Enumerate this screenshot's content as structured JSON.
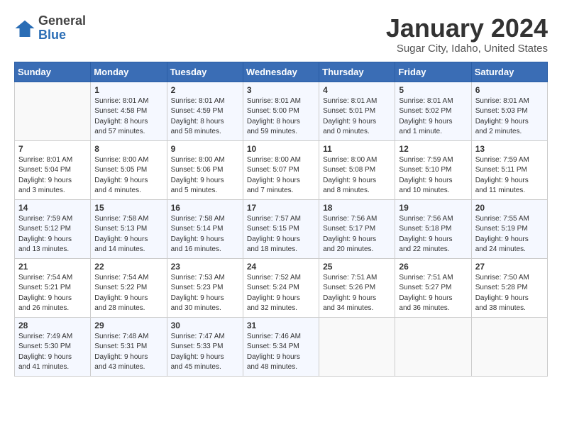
{
  "header": {
    "logo_general": "General",
    "logo_blue": "Blue",
    "month_title": "January 2024",
    "location": "Sugar City, Idaho, United States"
  },
  "days_of_week": [
    "Sunday",
    "Monday",
    "Tuesday",
    "Wednesday",
    "Thursday",
    "Friday",
    "Saturday"
  ],
  "weeks": [
    [
      {
        "day": "",
        "info": ""
      },
      {
        "day": "1",
        "info": "Sunrise: 8:01 AM\nSunset: 4:58 PM\nDaylight: 8 hours\nand 57 minutes."
      },
      {
        "day": "2",
        "info": "Sunrise: 8:01 AM\nSunset: 4:59 PM\nDaylight: 8 hours\nand 58 minutes."
      },
      {
        "day": "3",
        "info": "Sunrise: 8:01 AM\nSunset: 5:00 PM\nDaylight: 8 hours\nand 59 minutes."
      },
      {
        "day": "4",
        "info": "Sunrise: 8:01 AM\nSunset: 5:01 PM\nDaylight: 9 hours\nand 0 minutes."
      },
      {
        "day": "5",
        "info": "Sunrise: 8:01 AM\nSunset: 5:02 PM\nDaylight: 9 hours\nand 1 minute."
      },
      {
        "day": "6",
        "info": "Sunrise: 8:01 AM\nSunset: 5:03 PM\nDaylight: 9 hours\nand 2 minutes."
      }
    ],
    [
      {
        "day": "7",
        "info": "Sunrise: 8:01 AM\nSunset: 5:04 PM\nDaylight: 9 hours\nand 3 minutes."
      },
      {
        "day": "8",
        "info": "Sunrise: 8:00 AM\nSunset: 5:05 PM\nDaylight: 9 hours\nand 4 minutes."
      },
      {
        "day": "9",
        "info": "Sunrise: 8:00 AM\nSunset: 5:06 PM\nDaylight: 9 hours\nand 5 minutes."
      },
      {
        "day": "10",
        "info": "Sunrise: 8:00 AM\nSunset: 5:07 PM\nDaylight: 9 hours\nand 7 minutes."
      },
      {
        "day": "11",
        "info": "Sunrise: 8:00 AM\nSunset: 5:08 PM\nDaylight: 9 hours\nand 8 minutes."
      },
      {
        "day": "12",
        "info": "Sunrise: 7:59 AM\nSunset: 5:10 PM\nDaylight: 9 hours\nand 10 minutes."
      },
      {
        "day": "13",
        "info": "Sunrise: 7:59 AM\nSunset: 5:11 PM\nDaylight: 9 hours\nand 11 minutes."
      }
    ],
    [
      {
        "day": "14",
        "info": "Sunrise: 7:59 AM\nSunset: 5:12 PM\nDaylight: 9 hours\nand 13 minutes."
      },
      {
        "day": "15",
        "info": "Sunrise: 7:58 AM\nSunset: 5:13 PM\nDaylight: 9 hours\nand 14 minutes."
      },
      {
        "day": "16",
        "info": "Sunrise: 7:58 AM\nSunset: 5:14 PM\nDaylight: 9 hours\nand 16 minutes."
      },
      {
        "day": "17",
        "info": "Sunrise: 7:57 AM\nSunset: 5:15 PM\nDaylight: 9 hours\nand 18 minutes."
      },
      {
        "day": "18",
        "info": "Sunrise: 7:56 AM\nSunset: 5:17 PM\nDaylight: 9 hours\nand 20 minutes."
      },
      {
        "day": "19",
        "info": "Sunrise: 7:56 AM\nSunset: 5:18 PM\nDaylight: 9 hours\nand 22 minutes."
      },
      {
        "day": "20",
        "info": "Sunrise: 7:55 AM\nSunset: 5:19 PM\nDaylight: 9 hours\nand 24 minutes."
      }
    ],
    [
      {
        "day": "21",
        "info": "Sunrise: 7:54 AM\nSunset: 5:21 PM\nDaylight: 9 hours\nand 26 minutes."
      },
      {
        "day": "22",
        "info": "Sunrise: 7:54 AM\nSunset: 5:22 PM\nDaylight: 9 hours\nand 28 minutes."
      },
      {
        "day": "23",
        "info": "Sunrise: 7:53 AM\nSunset: 5:23 PM\nDaylight: 9 hours\nand 30 minutes."
      },
      {
        "day": "24",
        "info": "Sunrise: 7:52 AM\nSunset: 5:24 PM\nDaylight: 9 hours\nand 32 minutes."
      },
      {
        "day": "25",
        "info": "Sunrise: 7:51 AM\nSunset: 5:26 PM\nDaylight: 9 hours\nand 34 minutes."
      },
      {
        "day": "26",
        "info": "Sunrise: 7:51 AM\nSunset: 5:27 PM\nDaylight: 9 hours\nand 36 minutes."
      },
      {
        "day": "27",
        "info": "Sunrise: 7:50 AM\nSunset: 5:28 PM\nDaylight: 9 hours\nand 38 minutes."
      }
    ],
    [
      {
        "day": "28",
        "info": "Sunrise: 7:49 AM\nSunset: 5:30 PM\nDaylight: 9 hours\nand 41 minutes."
      },
      {
        "day": "29",
        "info": "Sunrise: 7:48 AM\nSunset: 5:31 PM\nDaylight: 9 hours\nand 43 minutes."
      },
      {
        "day": "30",
        "info": "Sunrise: 7:47 AM\nSunset: 5:33 PM\nDaylight: 9 hours\nand 45 minutes."
      },
      {
        "day": "31",
        "info": "Sunrise: 7:46 AM\nSunset: 5:34 PM\nDaylight: 9 hours\nand 48 minutes."
      },
      {
        "day": "",
        "info": ""
      },
      {
        "day": "",
        "info": ""
      },
      {
        "day": "",
        "info": ""
      }
    ]
  ]
}
